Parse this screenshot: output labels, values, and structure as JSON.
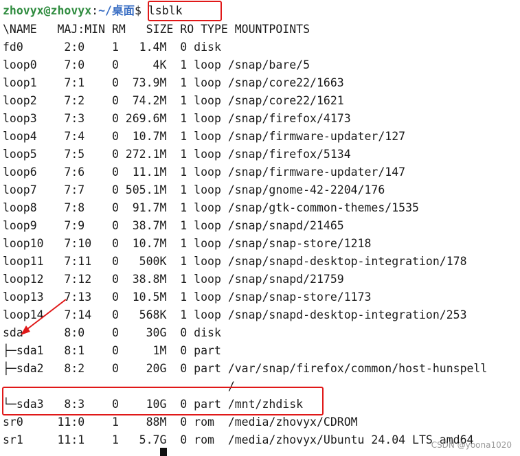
{
  "prompt": {
    "user_host": "zhovyx@zhovyx",
    "colon": ":",
    "path": "~/桌面",
    "dollar": "$ ",
    "command": "lsblk"
  },
  "header": "\\NAME   MAJ:MIN RM   SIZE RO TYPE MOUNTPOINTS",
  "rows": [
    "fd0      2:0    1   1.4M  0 disk",
    "loop0    7:0    0     4K  1 loop /snap/bare/5",
    "loop1    7:1    0  73.9M  1 loop /snap/core22/1663",
    "loop2    7:2    0  74.2M  1 loop /snap/core22/1621",
    "loop3    7:3    0 269.6M  1 loop /snap/firefox/4173",
    "loop4    7:4    0  10.7M  1 loop /snap/firmware-updater/127",
    "loop5    7:5    0 272.1M  1 loop /snap/firefox/5134",
    "loop6    7:6    0  11.1M  1 loop /snap/firmware-updater/147",
    "loop7    7:7    0 505.1M  1 loop /snap/gnome-42-2204/176",
    "loop8    7:8    0  91.7M  1 loop /snap/gtk-common-themes/1535",
    "loop9    7:9    0  38.7M  1 loop /snap/snapd/21465",
    "loop10   7:10   0  10.7M  1 loop /snap/snap-store/1218",
    "loop11   7:11   0   500K  1 loop /snap/snapd-desktop-integration/178",
    "loop12   7:12   0  38.8M  1 loop /snap/snapd/21759",
    "loop13   7:13   0  10.5M  1 loop /snap/snap-store/1173",
    "loop14   7:14   0   568K  1 loop /snap/snapd-desktop-integration/253",
    "sda      8:0    0    30G  0 disk",
    "├─sda1   8:1    0     1M  0 part",
    "├─sda2   8:2    0    20G  0 part /var/snap/firefox/common/host-hunspell",
    "                                 /",
    "└─sda3   8:3    0    10G  0 part /mnt/zhdisk",
    "sr0     11:0    1    88M  0 rom  /media/zhovyx/CDROM",
    "sr1     11:1    1   5.7G  0 rom  /media/zhovyx/Ubuntu 24.04 LTS amd64"
  ],
  "watermark": "CSDN @yoona1020"
}
